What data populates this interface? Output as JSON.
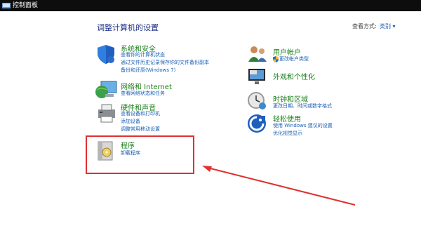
{
  "window": {
    "title": "控制面板"
  },
  "header": {
    "heading": "调整计算机的设置",
    "view_by_label": "查看方式:",
    "view_by_value": "类别"
  },
  "categories": {
    "system": {
      "title": "系统和安全",
      "links": [
        "查看你的计算机状态",
        "通过文件历史记录保存你的文件备份副本",
        "备份和还原(Windows 7)"
      ]
    },
    "network": {
      "title": "网络和 Internet",
      "links": [
        "查看网络状态和任务"
      ]
    },
    "hardware": {
      "title": "硬件和声音",
      "links": [
        "查看设备和打印机",
        "添加设备",
        "调整常用移动设置"
      ]
    },
    "programs": {
      "title": "程序",
      "links": [
        "卸载程序"
      ]
    },
    "accounts": {
      "title": "用户帐户",
      "links": [
        "更改帐户类型"
      ]
    },
    "appearance": {
      "title": "外观和个性化",
      "links": []
    },
    "clock": {
      "title": "时钟和区域",
      "links": [
        "更改日期、时间或数字格式"
      ]
    },
    "ease": {
      "title": "轻松使用",
      "links": [
        "使用 Windows 建议的设置",
        "优化视觉显示"
      ]
    }
  },
  "colors": {
    "annotation": "#e03030",
    "link": "#1a5fb4",
    "category_title": "#1a7f1a"
  }
}
